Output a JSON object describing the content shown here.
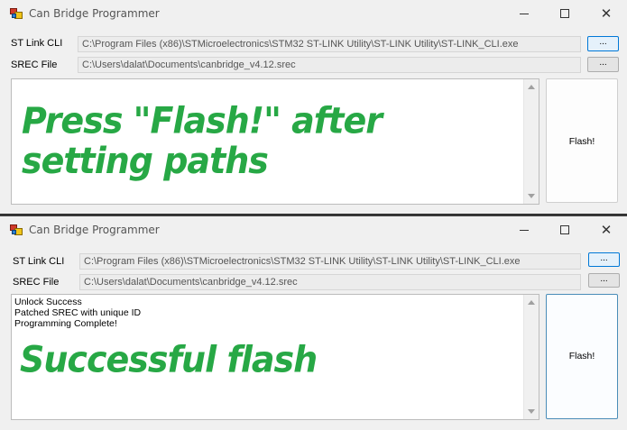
{
  "app": {
    "title": "Can Bridge Programmer",
    "window_controls": {
      "minimize_icon": "minimize-icon",
      "maximize_icon": "maximize-icon",
      "close_icon": "close-icon",
      "close_glyph": "✕"
    }
  },
  "form": {
    "stlink_label": "ST Link CLI",
    "srec_label": "SREC File",
    "stlink_path": "C:\\Program Files (x86)\\STMicroelectronics\\STM32 ST-LINK Utility\\ST-LINK Utility\\ST-LINK_CLI.exe",
    "srec_path": "C:\\Users\\dalat\\Documents\\canbridge_v4.12.srec",
    "browse_label": "...",
    "flash_label": "Flash!"
  },
  "top_window": {
    "caption_line1": "Press \"Flash!\" after",
    "caption_line2": "setting paths",
    "log_lines": []
  },
  "bottom_window": {
    "log_lines": [
      "Unlock Success",
      "Patched SREC with unique ID",
      "Programming Complete!"
    ],
    "caption": "Successful flash"
  },
  "colors": {
    "caption_green": "#27a845",
    "focus_border": "#0078d7"
  }
}
